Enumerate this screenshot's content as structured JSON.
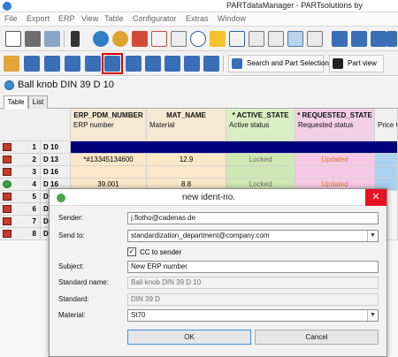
{
  "window": {
    "title": "PARTdataManager    -    PARTsolutions by"
  },
  "menu": [
    "File",
    "Export",
    "ERP",
    "View",
    "Table",
    "Configurator",
    "Extras",
    "Window"
  ],
  "toolbar1": {
    "icons": [
      "table-icon",
      "bmp-icon",
      "wrench-icon",
      "traffic-light-icon",
      "globe-icon",
      "globe-key-icon",
      "pdf-icon",
      "graph-icon",
      "din-icon",
      "equivalence-icon",
      "star-icon",
      "help-icon",
      "grid-icon",
      "grid-checked-icon",
      "grid-columns-icon",
      "grid-rows-icon",
      "tree-icon",
      "tree-add-icon",
      "tree-down-icon",
      "tree-refresh-icon"
    ]
  },
  "toolbar2": {
    "icons": [
      "key-icon",
      "user-db-icon",
      "database-icon",
      "database-edit-icon",
      "database-delete-icon",
      "new-ident-icon",
      "database-add-icon",
      "database-link-icon",
      "database-help-icon",
      "database-list-icon",
      "database-new-icon"
    ],
    "search_button": "Search and Part Selection",
    "partview_button": "Part view"
  },
  "document": {
    "heading": "Ball knob DIN 39 D 10"
  },
  "tabs": [
    "Table",
    "List"
  ],
  "table": {
    "columns": [
      {
        "field": "ERP_PDM_NUMBER",
        "label": "ERP number"
      },
      {
        "field": "MAT_NAME",
        "label": "Material"
      },
      {
        "field": "* ACTIVE_STATE",
        "label": "Active status"
      },
      {
        "field": "* REQUESTED_STATE",
        "label": "Requested status"
      },
      {
        "field": "",
        "label": "Price G"
      }
    ],
    "rows": [
      {
        "num": "1",
        "name": "D 10",
        "erp": "",
        "mat": "",
        "active": "",
        "requested": ""
      },
      {
        "num": "2",
        "name": "D 13",
        "erp": "*#13345134600",
        "mat": "12.9",
        "active": "Locked",
        "requested": "Updated"
      },
      {
        "num": "3",
        "name": "D 16",
        "erp": "",
        "mat": "",
        "active": "",
        "requested": ""
      },
      {
        "num": "4",
        "name": "D 16",
        "erp": "39.001",
        "mat": "8.8",
        "active": "Locked",
        "requested": "Updated"
      },
      {
        "num": "5",
        "name": "D",
        "erp": "",
        "mat": "",
        "active": "",
        "requested": ""
      },
      {
        "num": "6",
        "name": "D",
        "erp": "",
        "mat": "",
        "active": "",
        "requested": ""
      },
      {
        "num": "7",
        "name": "D",
        "erp": "",
        "mat": "",
        "active": "",
        "requested": ""
      },
      {
        "num": "8",
        "name": "D",
        "erp": "",
        "mat": "",
        "active": "",
        "requested": ""
      }
    ]
  },
  "dialog": {
    "title": "new ident-no.",
    "close": "✕",
    "sender_label": "Sender:",
    "sender_value": "j.flotho@cadenas.de",
    "sendto_label": "Send to:",
    "sendto_value": "standardization_department@company.com",
    "cc_label": "CC to sender",
    "cc_checked": "✓",
    "subject_label": "Subject:",
    "subject_value": "New ERP number",
    "stdname_label": "Standard name:",
    "stdname_value": "Ball knob DIN 39 D 10",
    "standard_label": "Standard:",
    "standard_value": "DIN 39 D",
    "material_label": "Material:",
    "material_value": "St70",
    "ok": "OK",
    "cancel": "Cancel"
  },
  "colors": {
    "selected_row": "#00007a",
    "active_col": "#cfe7b2",
    "requested_col": "#f7c9e6",
    "erp_col": "#fde7c9",
    "highlight": "#e00000",
    "close_button": "#e81123"
  }
}
